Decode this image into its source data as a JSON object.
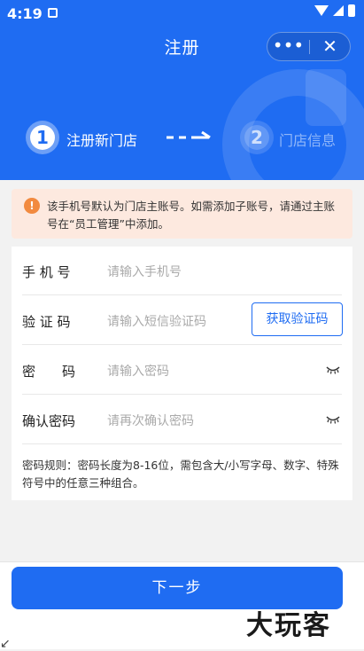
{
  "status_bar": {
    "time": "4:19"
  },
  "header": {
    "title": "注册",
    "capsule_more": "•••",
    "capsule_close": "✕"
  },
  "steps": [
    {
      "number": "1",
      "label": "注册新门店",
      "active": true
    },
    {
      "number": "2",
      "label": "门店信息",
      "active": false
    }
  ],
  "notice": {
    "icon": "warning-icon",
    "text": "该手机号默认为门店主账号。如需添加子账号，请通过主账号在“员工管理”中添加。"
  },
  "form": {
    "phone": {
      "label": "手 机 号",
      "placeholder": "请输入手机号"
    },
    "code": {
      "label": "验 证 码",
      "placeholder": "请输入短信验证码",
      "button": "获取验证码"
    },
    "password": {
      "label": "密　　码",
      "placeholder": "请输入密码"
    },
    "confirm": {
      "label": "确认密码",
      "placeholder": "请再次确认密码"
    },
    "rule": "密码规则：密码长度为8-16位，需包含大/小写字母、数字、特殊符号中的任意三种组合。"
  },
  "footer": {
    "next_button": "下一步"
  },
  "watermark": {
    "text": "大玩客"
  },
  "colors": {
    "primary": "#1f6cf2",
    "notice_bg": "#fde9df",
    "warning": "#f28a3f"
  }
}
